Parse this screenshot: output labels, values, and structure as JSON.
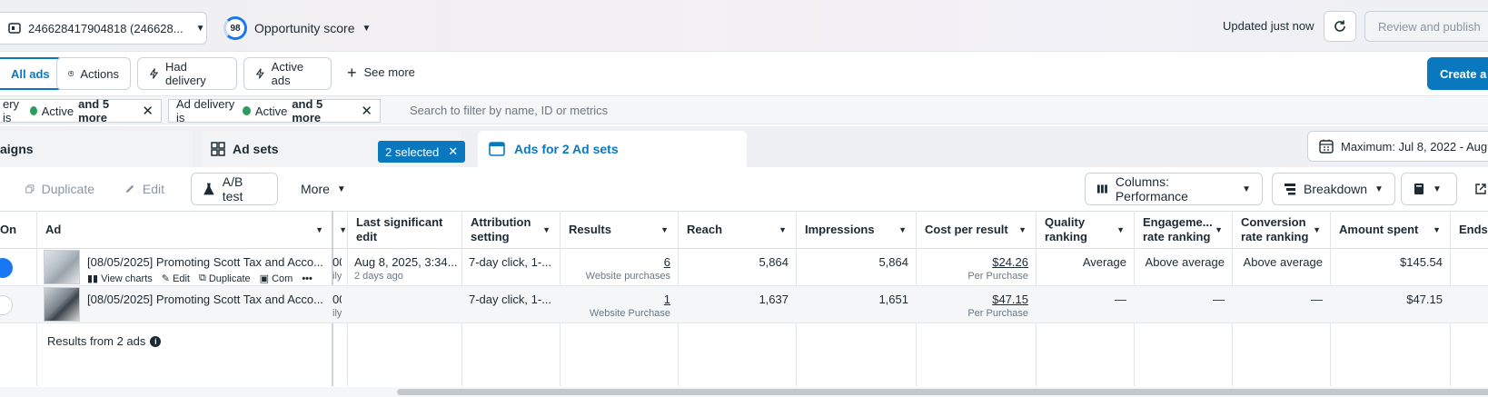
{
  "header": {
    "account": "246628417904818 (246628...",
    "opportunity_score": "98",
    "opportunity_label": "Opportunity score",
    "updated": "Updated just now",
    "review_publish": "Review and publish"
  },
  "filters": {
    "all_ads": "All ads",
    "actions": "Actions",
    "had_delivery": "Had delivery",
    "active_ads": "Active ads",
    "see_more": "See more",
    "create": "Create a"
  },
  "chips": [
    {
      "prefix": "ery is",
      "value": "Active",
      "more": "and 5 more"
    },
    {
      "prefix": "Ad delivery is",
      "value": "Active",
      "more": "and 5 more"
    }
  ],
  "search_placeholder": "Search to filter by name, ID or metrics",
  "tabs": {
    "campaigns": "aigns",
    "ad_sets": "Ad sets",
    "selected": "2 selected",
    "ads": "Ads for 2 Ad sets",
    "date_range": "Maximum: Jul 8, 2022 - Aug"
  },
  "toolbar": {
    "duplicate": "Duplicate",
    "edit": "Edit",
    "ab_test": "A/B test",
    "more": "More",
    "columns": "Columns: Performance",
    "breakdown": "Breakdown"
  },
  "columns": {
    "on": "On",
    "ad": "Ad",
    "last_edit": "Last significant edit",
    "attribution": "Attribution setting",
    "results": "Results",
    "reach": "Reach",
    "impressions": "Impressions",
    "cost_per_result": "Cost per result",
    "quality": "Quality ranking",
    "engagement": "Engageme... rate ranking",
    "conversion": "Conversion rate ranking",
    "amount_spent": "Amount spent",
    "ends": "Ends"
  },
  "rows": [
    {
      "name": "[08/05/2025] Promoting Scott Tax and Acco...",
      "view_charts": "View charts",
      "edit": "Edit",
      "duplicate": "Duplicate",
      "compare": "Com",
      "budget_clip": "00",
      "budget_sub": "ily",
      "last_edit": "Aug 8, 2025, 3:34...",
      "last_edit_sub": "2 days ago",
      "attribution": "7-day click, 1-...",
      "results": "6",
      "results_sub": "Website purchases",
      "reach": "5,864",
      "impressions": "5,864",
      "cost": "$24.26",
      "cost_sub": "Per Purchase",
      "quality": "Average",
      "engagement": "Above average",
      "conversion": "Above average",
      "spent": "$145.54"
    },
    {
      "name": "[08/05/2025] Promoting Scott Tax and Acco...",
      "budget_clip": "00",
      "budget_sub": "ily",
      "attribution": "7-day click, 1-...",
      "results": "1",
      "results_sub": "Website Purchase",
      "reach": "1,637",
      "impressions": "1,651",
      "cost": "$47.15",
      "cost_sub": "Per Purchase",
      "quality": "—",
      "engagement": "—",
      "conversion": "—",
      "spent": "$47.15"
    }
  ],
  "summary": "Results from 2 ads",
  "icons": [
    "ad-account-icon",
    "chevron-down-icon",
    "refresh-icon",
    "actions-icon",
    "lightning-icon",
    "plus-icon",
    "close-icon",
    "ad-sets-grid-icon",
    "ads-panel-icon",
    "calendar-icon",
    "duplicate-icon",
    "edit-icon",
    "flask-icon",
    "columns-icon",
    "breakdown-icon",
    "reports-icon",
    "export-icon",
    "info-icon",
    "chart-icon",
    "compare-icon",
    "more-icon"
  ]
}
